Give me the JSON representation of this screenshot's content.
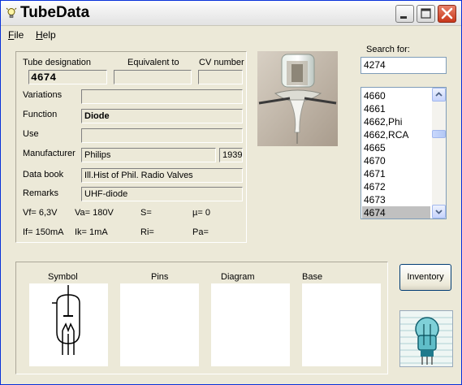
{
  "window": {
    "title": "TubeData"
  },
  "menu": [
    {
      "label_u": "F",
      "label_rest": "ile"
    },
    {
      "label_u": "H",
      "label_rest": "elp"
    }
  ],
  "headers": {
    "designation": "Tube designation",
    "equivalent": "Equivalent to",
    "cv": "CV number"
  },
  "tube": {
    "designation": "4674",
    "equivalent": "",
    "cv": "",
    "variations": "",
    "function": "Diode",
    "use": "",
    "manufacturer": "Philips",
    "year": "1939",
    "databook": "Ill.Hist of Phil. Radio Valves",
    "remarks": "UHF-diode"
  },
  "labels": {
    "variations": "Variations",
    "function": "Function",
    "use": "Use",
    "manufacturer": "Manufacturer",
    "databook": "Data book",
    "remarks": "Remarks"
  },
  "params": {
    "vf": "Vf= 6,3V",
    "va": "Va= 180V",
    "s": "S=",
    "mu": "µ=   0",
    "if": "If= 150mA",
    "ik": "Ik=  1mA",
    "ri": "Ri=",
    "pa": "Pa="
  },
  "search": {
    "label": "Search for:",
    "value": "4274"
  },
  "list": {
    "items": [
      "4660",
      "4661",
      "4662,Phi",
      "4662,RCA",
      "4665",
      "4670",
      "4671",
      "4672",
      "4673",
      "4674"
    ],
    "selected": "4674"
  },
  "images": {
    "symbol": "Symbol",
    "pins": "Pins",
    "diagram": "Diagram",
    "base": "Base"
  },
  "inventory_label": "Inventory",
  "colors": {
    "titlebar_close": "#c8361a",
    "list_selection": "#c0c0c0",
    "logo_accent": "#1f7a8c"
  }
}
